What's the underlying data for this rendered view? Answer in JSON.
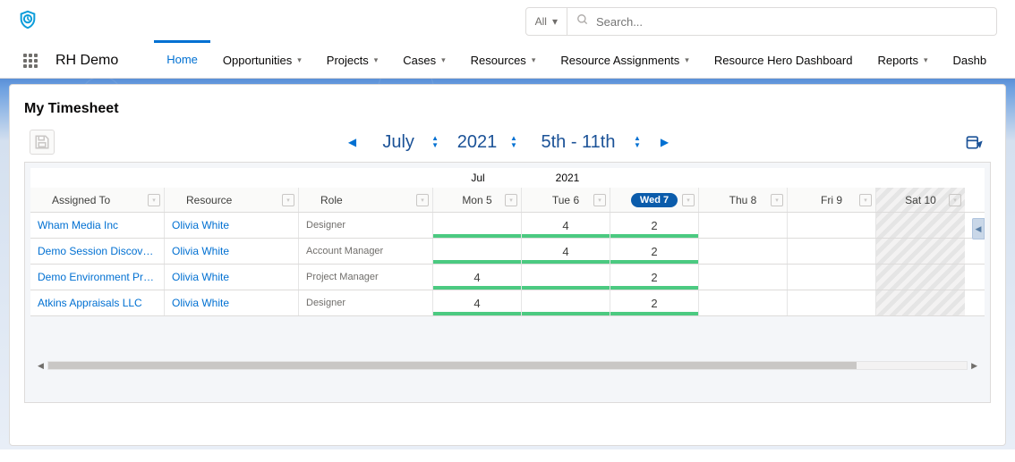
{
  "search": {
    "scope": "All",
    "placeholder": "Search..."
  },
  "app": {
    "name": "RH Demo"
  },
  "nav": {
    "items": [
      {
        "label": "Home",
        "active": true,
        "caret": false
      },
      {
        "label": "Opportunities",
        "active": false,
        "caret": true
      },
      {
        "label": "Projects",
        "active": false,
        "caret": true
      },
      {
        "label": "Cases",
        "active": false,
        "caret": true
      },
      {
        "label": "Resources",
        "active": false,
        "caret": true
      },
      {
        "label": "Resource Assignments",
        "active": false,
        "caret": true
      },
      {
        "label": "Resource Hero Dashboard",
        "active": false,
        "caret": false
      },
      {
        "label": "Reports",
        "active": false,
        "caret": true
      },
      {
        "label": "Dashb",
        "active": false,
        "caret": false
      }
    ]
  },
  "panel": {
    "title": "My Timesheet"
  },
  "range": {
    "month": "July",
    "year": "2021",
    "week": "5th - 11th"
  },
  "grid": {
    "super": {
      "jul": "Jul",
      "year": "2021"
    },
    "headers": {
      "assigned": "Assigned To",
      "resource": "Resource",
      "role": "Role"
    },
    "days": [
      {
        "label": "Mon 5",
        "today": false
      },
      {
        "label": "Tue 6",
        "today": false
      },
      {
        "label": "Wed 7",
        "today": true
      },
      {
        "label": "Thu 8",
        "today": false
      },
      {
        "label": "Fri 9",
        "today": false
      },
      {
        "label": "Sat 10",
        "today": false,
        "sat": true
      }
    ],
    "rows": [
      {
        "assigned": "Wham Media Inc",
        "resource": "Olivia White",
        "role": "Designer",
        "cells": [
          "",
          "4",
          "2",
          "",
          "",
          ""
        ],
        "green": [
          true,
          true,
          true,
          false,
          false,
          false
        ]
      },
      {
        "assigned": "Demo Session Discovery",
        "resource": "Olivia White",
        "role": "Account Manager",
        "cells": [
          "",
          "4",
          "2",
          "",
          "",
          ""
        ],
        "green": [
          true,
          true,
          true,
          false,
          false,
          false
        ]
      },
      {
        "assigned": "Demo Environment Prep...",
        "resource": "Olivia White",
        "role": "Project Manager",
        "cells": [
          "4",
          "",
          "2",
          "",
          "",
          ""
        ],
        "green": [
          true,
          true,
          true,
          false,
          false,
          false
        ]
      },
      {
        "assigned": "Atkins Appraisals LLC",
        "resource": "Olivia White",
        "role": "Designer",
        "cells": [
          "4",
          "",
          "2",
          "",
          "",
          ""
        ],
        "green": [
          true,
          true,
          true,
          false,
          false,
          false
        ]
      }
    ]
  }
}
